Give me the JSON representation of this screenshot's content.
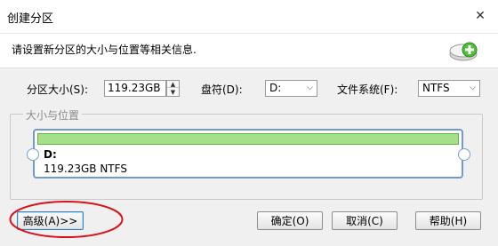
{
  "window": {
    "title": "创建分区",
    "close_glyph": "✕"
  },
  "header": {
    "instruction": "请设置新分区的大小与位置等相关信息.",
    "icon": "add-partition-icon",
    "icon_color": "#4fbf3a"
  },
  "form": {
    "size_label": "分区大小(S):",
    "size_value": "119.23GB",
    "drive_label": "盘符(D):",
    "drive_value": "D:",
    "fs_label": "文件系统(F):",
    "fs_value": "NTFS"
  },
  "group": {
    "title": "大小与位置"
  },
  "partition": {
    "drive": "D:",
    "info": "119.23GB NTFS",
    "bar_color": "#a4e087"
  },
  "buttons": {
    "advanced": "高级(A)>>",
    "ok": "确定(O)",
    "cancel": "取消(C)",
    "help": "帮助(H)"
  },
  "annotation": {
    "color": "#d9121c"
  }
}
